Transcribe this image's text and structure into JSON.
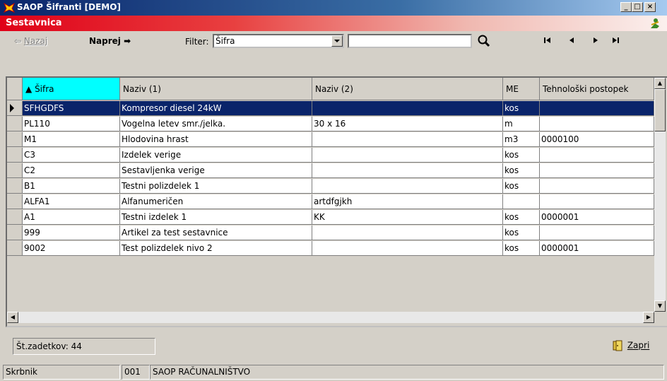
{
  "window": {
    "title": "SAOP Šifranti [DEMO]"
  },
  "header": {
    "title": "Sestavnica"
  },
  "toolbar": {
    "back_label": "Nazaj",
    "forward_label": "Naprej",
    "filter_label": "Filter:",
    "filter_value": "Šifra",
    "search_value": ""
  },
  "grid": {
    "columns": [
      "Šifra",
      "Naziv (1)",
      "Naziv (2)",
      "ME",
      "Tehnološki postopek"
    ],
    "rows": [
      [
        "SFHGDFS",
        "Kompresor diesel 24kW",
        "",
        "kos",
        ""
      ],
      [
        "PL110",
        "Vogelna letev smr./jelka.",
        "30 x 16",
        "m",
        ""
      ],
      [
        "M1",
        "Hlodovina hrast",
        "",
        "m3",
        "0000100"
      ],
      [
        "C3",
        "Izdelek verige",
        "",
        "kos",
        ""
      ],
      [
        "C2",
        "Sestavljenka verige",
        "",
        "kos",
        ""
      ],
      [
        "B1",
        "Testni polizdelek 1",
        "",
        "kos",
        ""
      ],
      [
        "ALFA1",
        "Alfanumeričen",
        "artdfgjkh",
        "",
        ""
      ],
      [
        "A1",
        "Testni izdelek 1",
        "KK",
        "kos",
        "0000001"
      ],
      [
        "999",
        "Artikel za test sestavnice",
        "",
        "kos",
        ""
      ],
      [
        "9002",
        "Test polizdelek nivo 2",
        "",
        "kos",
        "0000001"
      ]
    ],
    "selected_row": 0
  },
  "footer": {
    "count_label": "Št.zadetkov: 44",
    "close_label": "Zapri"
  },
  "statusbar": {
    "user": "Skrbnik",
    "company_code": "001",
    "company_name": "SAOP RAČUNALNIŠTVO"
  }
}
